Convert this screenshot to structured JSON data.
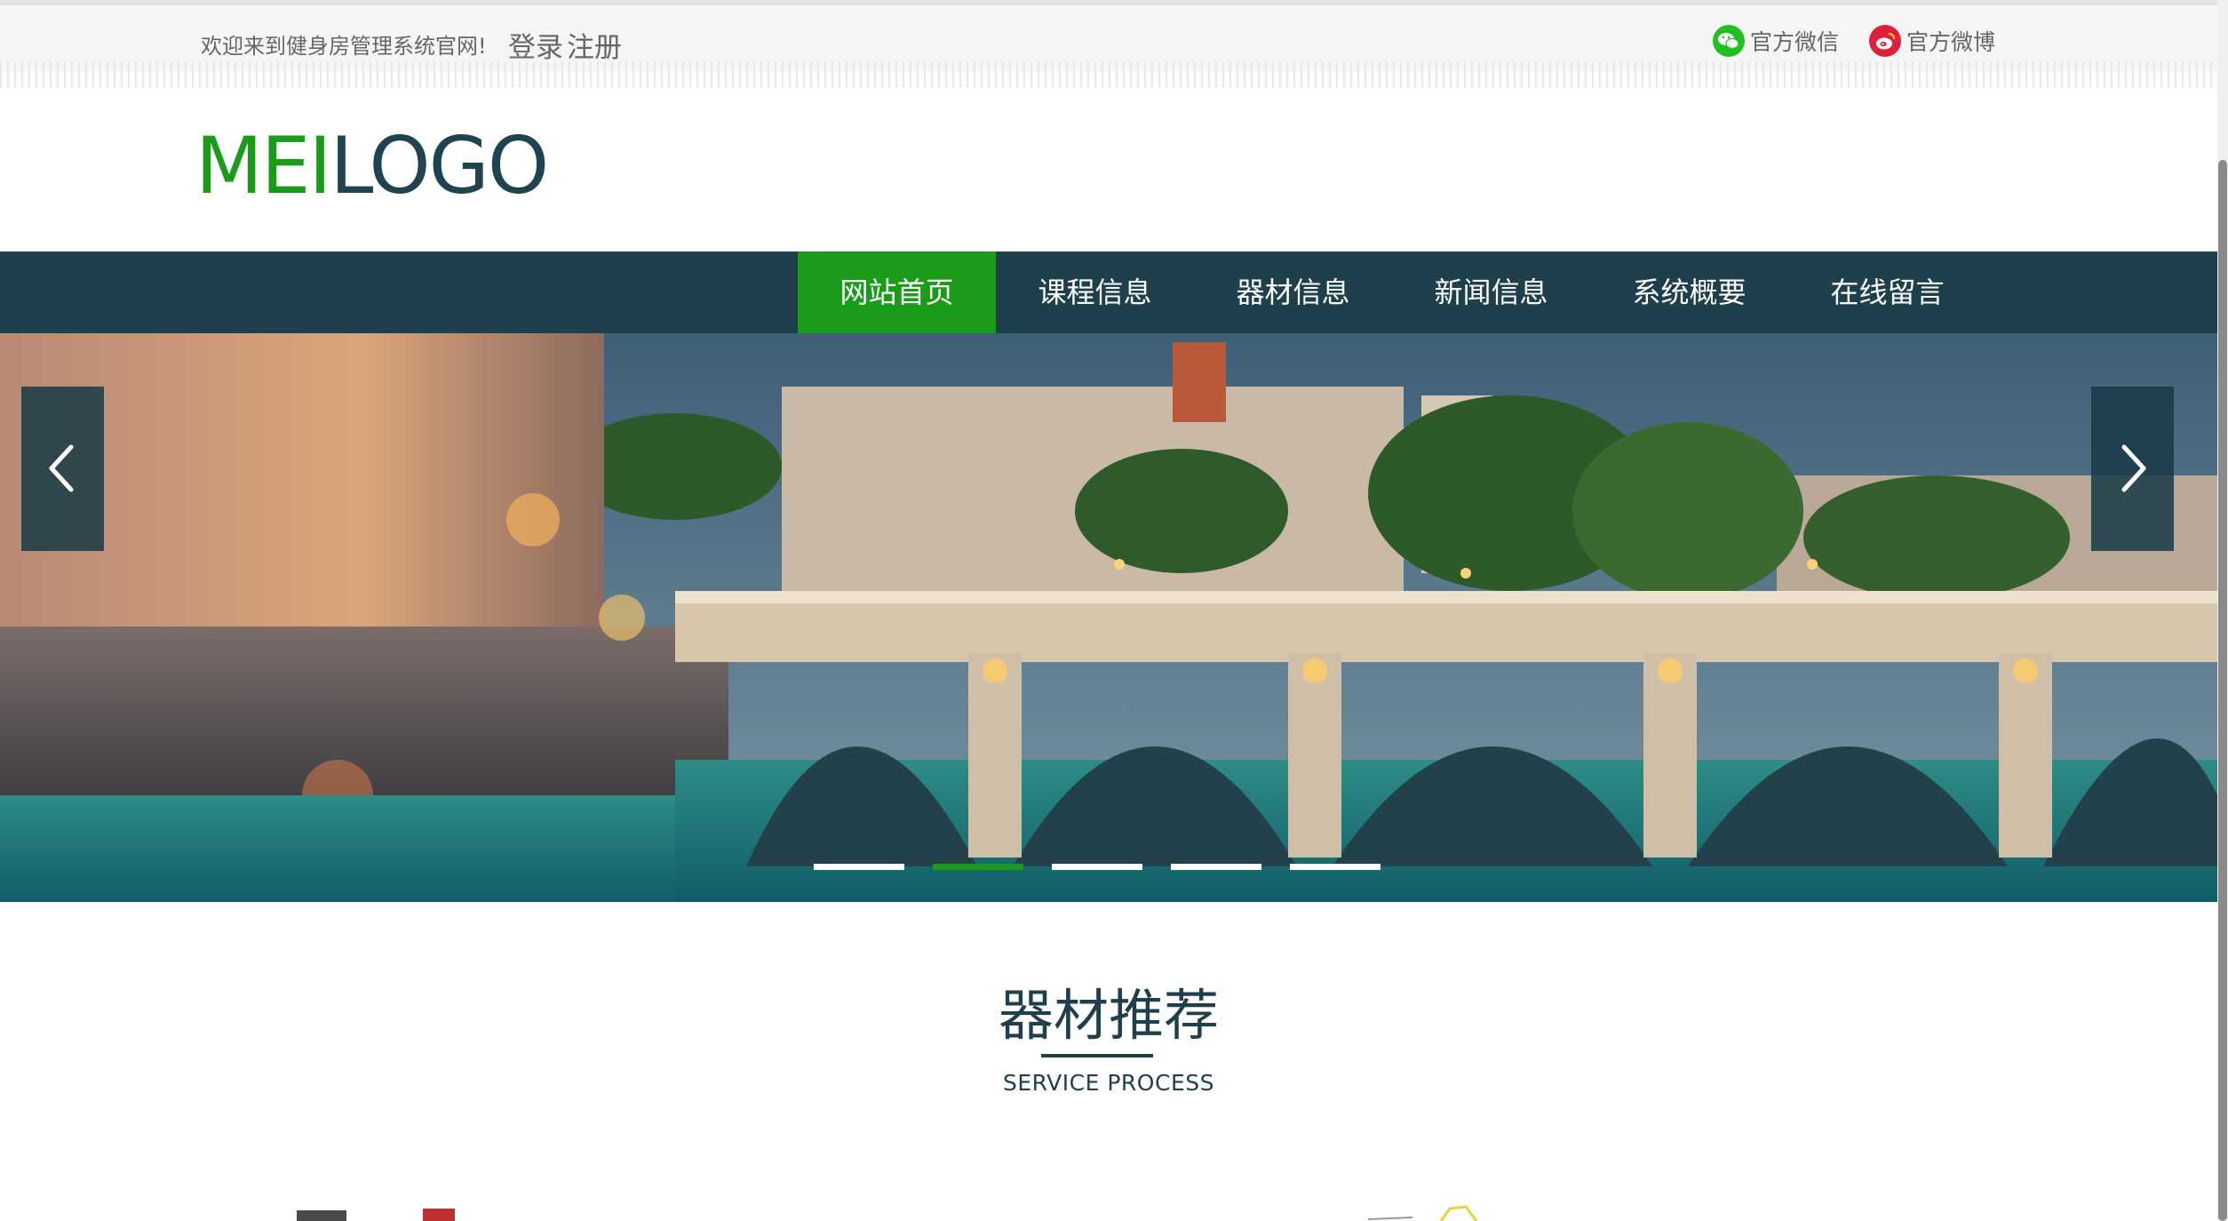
{
  "topbar": {
    "welcome": "欢迎来到健身房管理系统官网!",
    "login": "登录",
    "register": "注册",
    "wechat_label": "官方微信",
    "weibo_label": "官方微博"
  },
  "logo": {
    "part1": "MEI",
    "part2": "LOGO"
  },
  "nav": {
    "items": [
      {
        "label": "网站首页",
        "active": true
      },
      {
        "label": "课程信息",
        "active": false
      },
      {
        "label": "器材信息",
        "active": false
      },
      {
        "label": "新闻信息",
        "active": false
      },
      {
        "label": "系统概要",
        "active": false
      },
      {
        "label": "在线留言",
        "active": false
      }
    ]
  },
  "banner": {
    "slide_count": 5,
    "active_index": 1
  },
  "section": {
    "title": "器材推荐",
    "subtitle": "SERVICE PROCESS"
  },
  "colors": {
    "brand_green": "#1a9b1a",
    "nav_dark": "#1e3f4c",
    "wechat_green": "#20c020",
    "weibo_red": "#e0203a"
  }
}
